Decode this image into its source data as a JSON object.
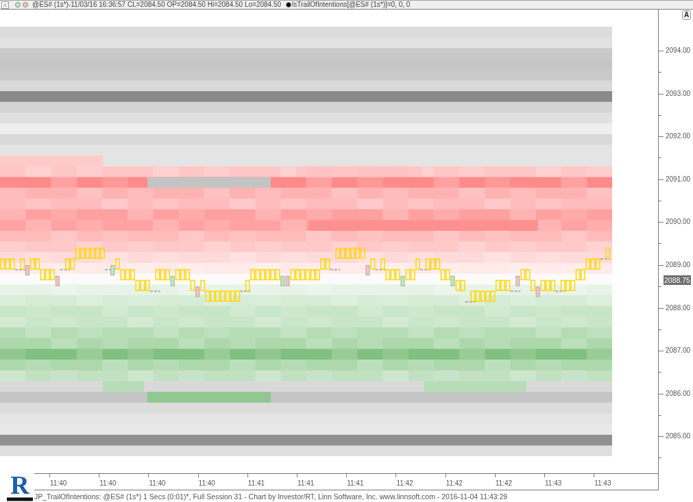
{
  "header": {
    "status": "@ES# (1s*)-11/03/16 16:36:57 CL=2084.50 OP=2084.50 Hi=2084.50 Lo=2084.50",
    "indicator": "lsTrailOfIntentions[@ES# (1s*)]=0, 0, 0"
  },
  "autoscale_button": "A",
  "price_axis": {
    "ticks": [
      "2094.00",
      "2093.00",
      "2092.00",
      "2091.00",
      "2090.00",
      "2089.00",
      "2088.00",
      "2087.00",
      "2086.00",
      "2085.00"
    ],
    "last_price": "2088.75"
  },
  "time_axis": {
    "ticks": [
      "11:40",
      "11:40",
      "11:40",
      "11:40",
      "11:41",
      "11:41",
      "11:41",
      "11:42",
      "11:42",
      "11:42",
      "11:43",
      "11:43"
    ]
  },
  "logo": {
    "letter": "R"
  },
  "footer": "JP_TrailOfIntentions: @ES# (1s*) 1 Secs (0:01)*, Full Session 31 - Chart by Investor/RT, Linn Software, Inc. www.linnsoft.com - 2016-11-04 11:43:29"
}
